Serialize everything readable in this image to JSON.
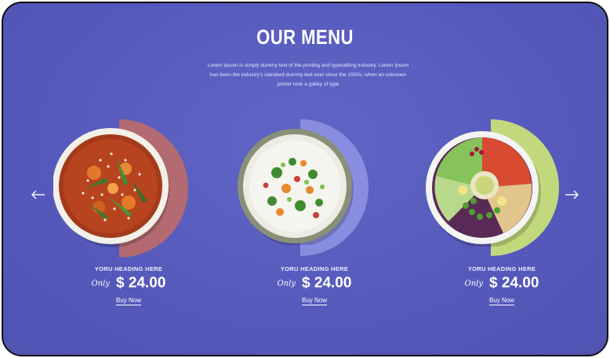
{
  "menu": {
    "title": "OUR MENU",
    "intro": "Lorem Ipsum is simply dummy text of the printing and typesetting industry. Lorem Ipsum has been the industry's standard dummy text ever since the 1500s, when an unknown printer took a galley of type"
  },
  "colors": {
    "background": "#5559bb",
    "arc_soup": "#b86a6c",
    "arc_rice": "#8a8fe0",
    "arc_salad": "#c6dc7a"
  },
  "items": [
    {
      "name": "YORU HEADING HERE",
      "only": "Only",
      "price": "$ 24.00",
      "cta": "Buy Now",
      "image": "soup-bowl"
    },
    {
      "name": "YORU HEADING HERE",
      "only": "Only",
      "price": "$ 24.00",
      "cta": "Buy Now",
      "image": "rice-bowl"
    },
    {
      "name": "YORU HEADING HERE",
      "only": "Only",
      "price": "$ 24.00",
      "cta": "Buy Now",
      "image": "salad-bowl"
    }
  ],
  "nav": {
    "prev_icon": "arrow-left-icon",
    "next_icon": "arrow-right-icon"
  }
}
